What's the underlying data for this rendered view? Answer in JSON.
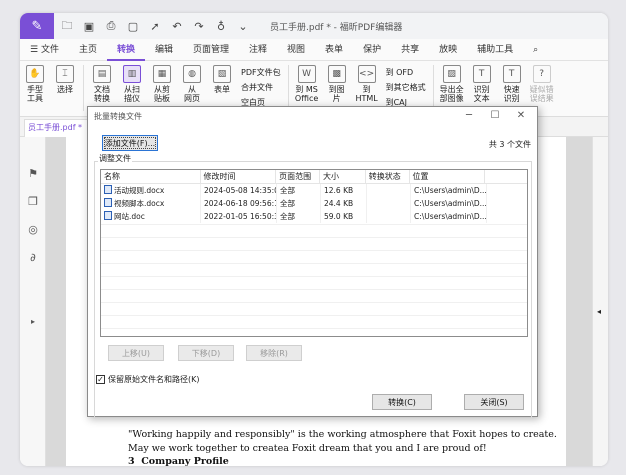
{
  "app": {
    "title": "员工手册.pdf * - 福昕PDF编辑器"
  },
  "menubar": {
    "items": [
      "文件",
      "主页",
      "转换",
      "编辑",
      "页面管理",
      "注释",
      "视图",
      "表单",
      "保护",
      "共享",
      "放映",
      "辅助工具"
    ],
    "active": "转换"
  },
  "ribbon": {
    "hand": "手型\n工具",
    "select": "选择",
    "doc_convert": "文档\n转换",
    "from_scan": "从扫\n描仪",
    "from_clip": "从剪\n贴板",
    "from_web": "从\n网页",
    "form": "表单",
    "pdf_pkg": "PDF文件包",
    "merge": "合并文件",
    "blank_page": "空白页",
    "to_office": "到 MS\nOffice",
    "to_image": "到图\n片",
    "to_html": "到\nHTML",
    "to_ofd": "到 OFD",
    "to_other": "到其它格式",
    "to_caj": "到CAJ",
    "export_img": "导出全\n部图像",
    "ocr": "识别\n文本",
    "quick_ocr": "快速\n识别",
    "suspect": "疑似错\n误结果"
  },
  "doc": {
    "tab": "员工手册.pdf *",
    "line1": "\"Working happily and responsibly\" is the working atmosphere that Foxit hopes to create.",
    "line2": "May we work together to createa Foxit dream that you and I are proud of!",
    "line3_num": "3",
    "line3": "Company Profile"
  },
  "dialog": {
    "title": "批量转换文件",
    "add_file": "添加文件(F)...",
    "file_count": "共 3 个文件",
    "group_label": "调整文件",
    "columns": [
      "名称",
      "修改时间",
      "页面范围",
      "大小",
      "转换状态",
      "位置"
    ],
    "rows": [
      {
        "name": "活动规则.docx",
        "time": "2024-05-08 14:35:06",
        "range": "全部",
        "size": "12.6 KB",
        "status": "",
        "location": "C:\\Users\\admin\\D..."
      },
      {
        "name": "视频脚本.docx",
        "time": "2024-06-18 09:56:10",
        "range": "全部",
        "size": "24.4 KB",
        "status": "",
        "location": "C:\\Users\\admin\\D..."
      },
      {
        "name": "网站.doc",
        "time": "2022-01-05 16:50:33",
        "range": "全部",
        "size": "59.0 KB",
        "status": "",
        "location": "C:\\Users\\admin\\D..."
      }
    ],
    "move_up": "上移(U)",
    "move_down": "下移(D)",
    "remove": "移除(R)",
    "keep_name": "保留原始文件名和路径(K)",
    "convert": "转换(C)",
    "close": "关闭(S)"
  }
}
